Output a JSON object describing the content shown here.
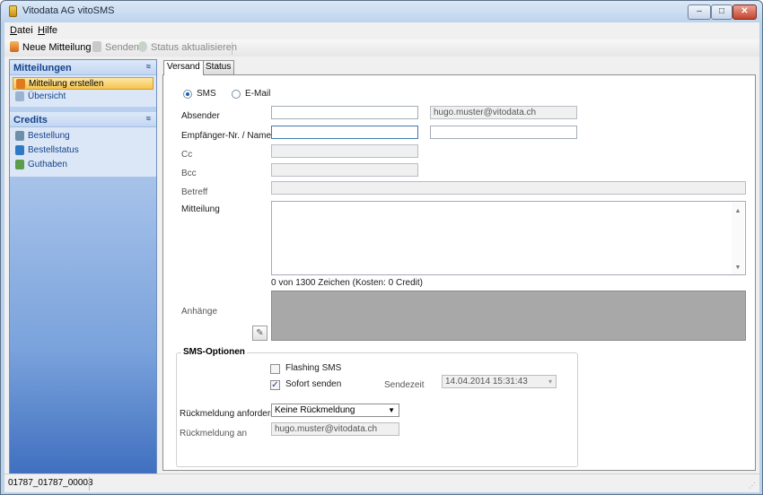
{
  "window": {
    "title": "Vitodata AG vitoSMS",
    "min_symbol": "–",
    "max_symbol": "□",
    "close_symbol": "✕"
  },
  "menubar": {
    "items": [
      {
        "label": "Datei",
        "accel": "D",
        "rest": "atei"
      },
      {
        "label": "Hilfe",
        "accel": "H",
        "rest": "ilfe"
      }
    ]
  },
  "toolbar": {
    "new_message": "Neue Mitteilung",
    "send": "Senden",
    "update_status": "Status aktualisieren"
  },
  "sidebar": {
    "groups": [
      {
        "title": "Mitteilungen",
        "collapse_symbol": "≈",
        "items": [
          {
            "label": "Mitteilung erstellen",
            "icon": "message-edit-icon",
            "active": true
          },
          {
            "label": "Übersicht",
            "icon": "overview-icon",
            "active": false
          }
        ]
      },
      {
        "title": "Credits",
        "collapse_symbol": "≈",
        "items": [
          {
            "label": "Bestellung",
            "icon": "order-icon",
            "active": false
          },
          {
            "label": "Bestellstatus",
            "icon": "order-status-icon",
            "active": false
          },
          {
            "label": "Guthaben",
            "icon": "balance-icon",
            "active": false
          }
        ]
      }
    ]
  },
  "tabs": [
    {
      "label": "Versand",
      "active": true
    },
    {
      "label": "Status",
      "active": false
    }
  ],
  "form": {
    "channel_sms": "SMS",
    "channel_email": "E-Mail",
    "sender_label": "Absender",
    "sender_value": "",
    "sender_email": "hugo.muster@vitodata.ch",
    "recipient_label": "Empfänger-Nr. / Name",
    "recipient_value": "",
    "recipient_name_value": "",
    "cc_label": "Cc",
    "bcc_label": "Bcc",
    "subject_label": "Betreff",
    "message_label": "Mitteilung",
    "message_value": "",
    "char_count": "0 von 1300 Zeichen (Kosten: 0 Credit)",
    "attachments_label": "Anhänge"
  },
  "sms_options": {
    "title": "SMS-Optionen",
    "flashing_label": "Flashing SMS",
    "flashing_checked": false,
    "send_now_label": "Sofort senden",
    "send_now_checked": true,
    "send_time_label": "Sendezeit",
    "send_time_value": "14.04.2014 15:31:43",
    "feedback_label": "Rückmeldung anfordern",
    "feedback_value": "Keine Rückmeldung",
    "feedback_to_label": "Rückmeldung an",
    "feedback_to_value": "hugo.muster@vitodata.ch"
  },
  "statusbar": {
    "id_text": "01787_01787_00003"
  },
  "colors": {
    "active_item": "#f6c34c",
    "sidebar_top": "#c5d9f3",
    "sidebar_bottom": "#3f6fbf",
    "header_text": "#15428b"
  }
}
